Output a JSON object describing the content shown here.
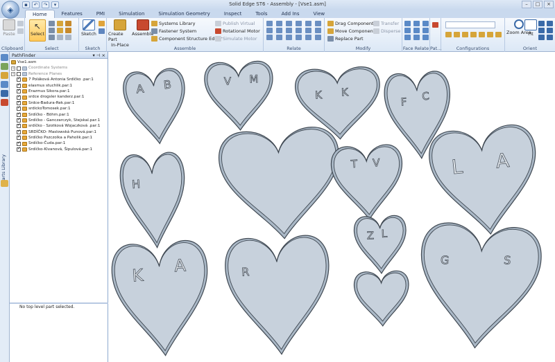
{
  "window": {
    "title": "Solid Edge ST6 - Assembly - [Vse1.asm]"
  },
  "tabs": [
    "Home",
    "Features",
    "PMI",
    "Simulation",
    "Simulation Geometry",
    "Inspect",
    "Tools",
    "Add Ins",
    "View"
  ],
  "ribbon": {
    "clipboard": {
      "label": "Clipboard",
      "paste": "Paste"
    },
    "select": {
      "label": "Select",
      "select": "Select"
    },
    "sketch": {
      "label": "Sketch",
      "sketch": "Sketch"
    },
    "assemble": {
      "label": "Assemble",
      "create_part": "Create Part",
      "in_place": "In-Place",
      "assemble": "Assemble",
      "systems_library": "Systems Library",
      "fastener_system": "Fastener System",
      "component_structure_editor": "Component Structure Editor",
      "publish_virtual": "Publish Virtual",
      "rotational_motor": "Rotational Motor",
      "simulate_motor": "Simulate Motor"
    },
    "relate": {
      "label": "Relate"
    },
    "modify": {
      "label": "Modify",
      "drag_component": "Drag Component",
      "move_components": "Move Components",
      "replace_part": "Replace Part",
      "transfer": "Transfer",
      "disperse": "Disperse"
    },
    "face_relate": {
      "label": "Face Relate"
    },
    "pattern": {
      "label": "Pat..."
    },
    "configurations": {
      "label": "Configurations"
    },
    "orient": {
      "label": "Orient",
      "zoom_area": "Zoom Area",
      "fit": "Fit"
    }
  },
  "sidebar": {
    "parts_library": "Parts Library"
  },
  "pathfinder": {
    "title": "PathFinder",
    "root": "Vse1.asm",
    "items": [
      {
        "label": "Coordinate Systems",
        "type": "folder",
        "checked": false
      },
      {
        "label": "Reference Planes",
        "type": "folder",
        "checked": false
      },
      {
        "label": "7  Poláková Antonia Srdíčko .par:1",
        "type": "part",
        "checked": true
      },
      {
        "label": "elasmus stuchlik.par:1",
        "type": "part",
        "checked": true
      },
      {
        "label": "Erazmus  Sikora.par:1",
        "type": "part",
        "checked": true
      },
      {
        "label": "srdce drogsler kanderz.par:1",
        "type": "part",
        "checked": true
      },
      {
        "label": "Srdce-Badura-Rek.par:1",
        "type": "part",
        "checked": true
      },
      {
        "label": "srdickoTomosek.par:1",
        "type": "part",
        "checked": true
      },
      {
        "label": "Srdíčko - Böhm.par:1",
        "type": "part",
        "checked": true
      },
      {
        "label": "Srdíčko - Ganczarczyk, Stejskal.par:1",
        "type": "part",
        "checked": true
      },
      {
        "label": "srdíčko - Szotková Wojaczková .par:1",
        "type": "part",
        "checked": true
      },
      {
        "label": "SRDÍČKO- Maslowská Punová.par:1",
        "type": "part",
        "checked": true
      },
      {
        "label": "Srdíčko Pszczolka a Paholik.par:1",
        "type": "part",
        "checked": true
      },
      {
        "label": "Srdíčko-Čuda.par:1",
        "type": "part",
        "checked": true
      },
      {
        "label": "Srdíčko-Klvanová, Šipulová.par:1",
        "type": "part",
        "checked": true
      }
    ],
    "status": "No top level part selected."
  },
  "hearts": [
    {
      "letters": [
        "A",
        "B"
      ]
    },
    {
      "letters": [
        "V",
        "M"
      ]
    },
    {
      "letters": [
        "K",
        "K"
      ]
    },
    {
      "letters": [
        "F",
        "C"
      ]
    },
    {
      "letters": [
        "H"
      ]
    },
    {
      "letters": []
    },
    {
      "letters": [
        "T",
        "V"
      ]
    },
    {
      "letters": [
        "L",
        "A"
      ]
    },
    {
      "letters": [
        "Z",
        "L"
      ]
    },
    {
      "letters": [
        "K",
        "A"
      ]
    },
    {
      "letters": [
        "R"
      ]
    },
    {
      "letters": []
    },
    {
      "letters": [
        "G",
        "S"
      ]
    }
  ],
  "colors": {
    "heart_floor": "#c7d1dc",
    "heart_wall": "#aab8c6",
    "heart_edge": "#3f4852"
  }
}
